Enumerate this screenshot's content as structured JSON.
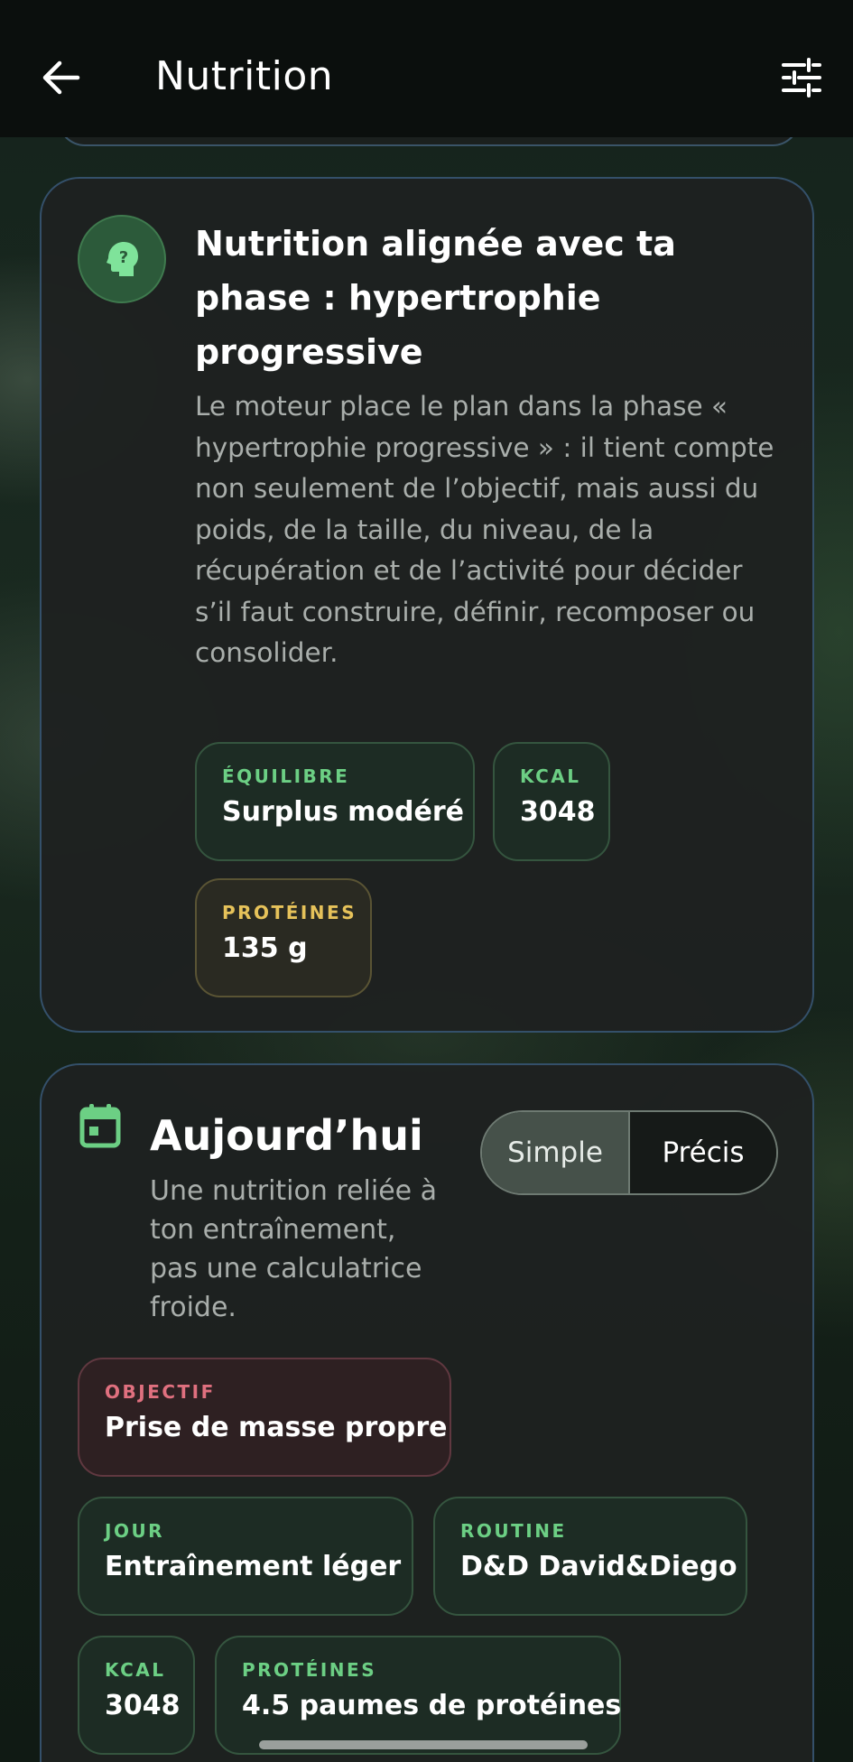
{
  "header": {
    "title": "Nutrition",
    "back_icon": "arrow-left-icon",
    "filter_icon": "sliders-icon"
  },
  "phase_card": {
    "icon": "head-question-icon",
    "title": "Nutrition alignée avec ta phase : hypertrophie progressive",
    "description": "Le moteur place le plan dans la phase « hypertrophie progressive » : il tient compte non seulement de l’objectif, mais aussi du poids, de la taille, du niveau, de la récupération et de l’activité pour décider s’il faut construire, définir, recomposer ou consolider.",
    "chips": {
      "equilibre": {
        "label": "ÉQUILIBRE",
        "value": "Surplus modéré"
      },
      "kcal": {
        "label": "KCAL",
        "value": "3048"
      },
      "proteines": {
        "label": "PROTÉINES",
        "value": "135 g"
      }
    }
  },
  "today_card": {
    "icon": "calendar-icon",
    "title": "Aujourd’hui",
    "subtitle": "Une nutrition reliée à ton entraînement, pas une calculatrice froide.",
    "mode_toggle": {
      "options": [
        "Simple",
        "Précis"
      ],
      "selected": "Simple"
    },
    "chips": {
      "objectif": {
        "label": "OBJECTIF",
        "value": "Prise de masse propre"
      },
      "jour": {
        "label": "JOUR",
        "value": "Entraînement léger"
      },
      "routine": {
        "label": "ROUTINE",
        "value": "D&D David&Diego"
      },
      "kcal": {
        "label": "KCAL",
        "value": "3048"
      },
      "proteines": {
        "label": "PROTÉINES",
        "value": "4.5 paumes de protéines"
      }
    }
  },
  "colors": {
    "accent_green": "#6ccf84",
    "accent_yellow": "#e6c25a",
    "accent_red": "#e0707f",
    "card_border": "#34506a",
    "app_bar": "#0b0f0d"
  }
}
